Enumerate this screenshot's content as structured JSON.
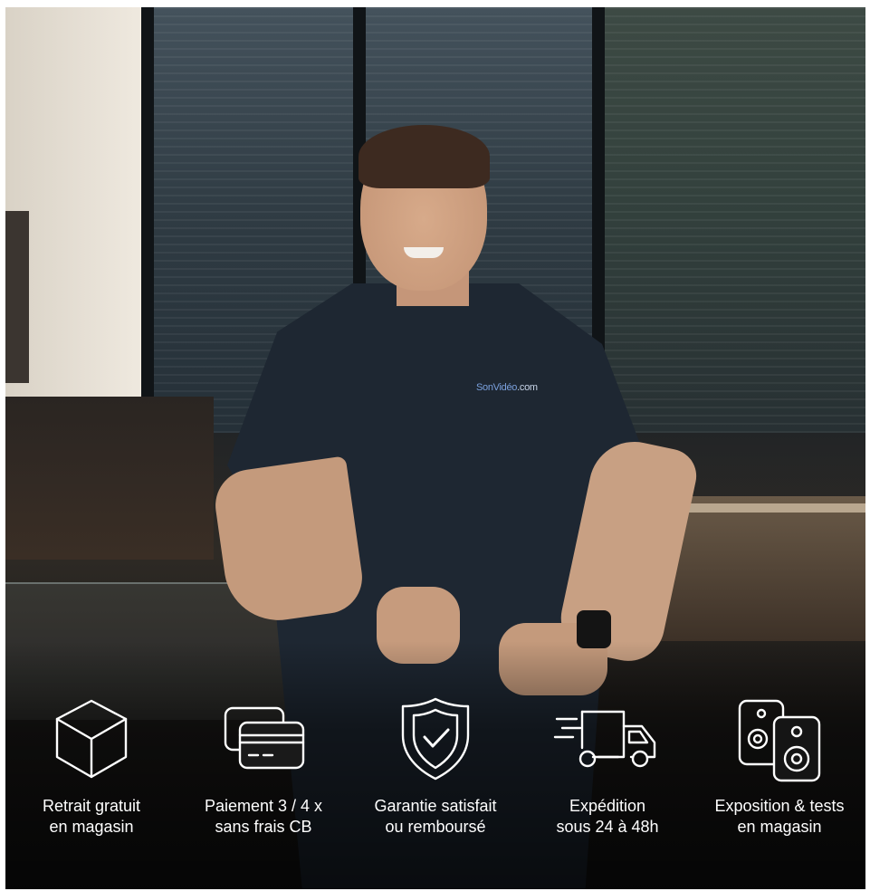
{
  "photo": {
    "subject": "man-in-polo",
    "shirt_logo": {
      "brand": "SonVidéo",
      "suffix": ".com",
      "color": "#7aa0dd"
    }
  },
  "features": [
    {
      "icon": "box-icon",
      "line1": "Retrait gratuit",
      "line2": "en magasin"
    },
    {
      "icon": "credit-card-icon",
      "line1": "Paiement 3 / 4 x",
      "line2": "sans frais CB"
    },
    {
      "icon": "shield-check-icon",
      "line1": "Garantie satisfait",
      "line2": "ou remboursé"
    },
    {
      "icon": "delivery-truck-icon",
      "line1": "Expédition",
      "line2": "sous 24 à 48h"
    },
    {
      "icon": "speakers-icon",
      "line1": "Exposition & tests",
      "line2": "en magasin"
    }
  ],
  "colors": {
    "text": "#ffffff",
    "icon_stroke": "#ffffff"
  }
}
